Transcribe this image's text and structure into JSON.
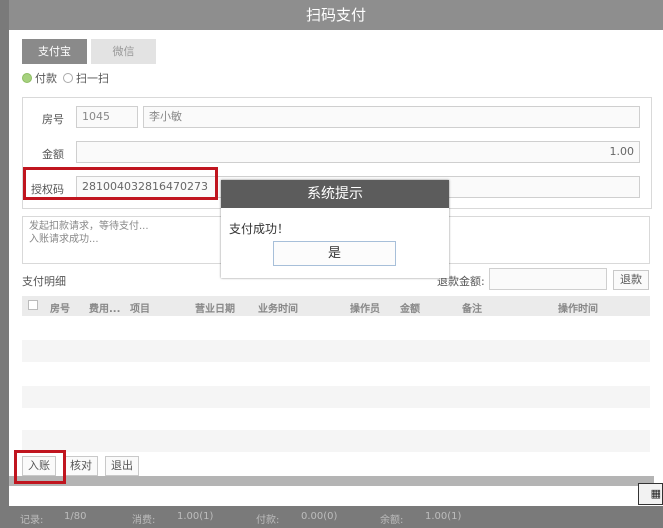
{
  "window": {
    "title": "扫码支付"
  },
  "tabs": [
    {
      "label": "支付宝",
      "active": true
    },
    {
      "label": "微信",
      "active": false
    }
  ],
  "mode": {
    "options": [
      {
        "label": "付款",
        "selected": true
      },
      {
        "label": "扫一扫",
        "selected": false
      }
    ]
  },
  "form": {
    "room_label": "房号",
    "room_value": "1045",
    "guest_value": "李小敏",
    "amount_label": "金额",
    "amount_value": "1.00",
    "auth_label": "授权码",
    "auth_value": "281004032816470273"
  },
  "log": {
    "lines": [
      "发起扣款请求，等待支付...",
      "入账请求成功..."
    ]
  },
  "details": {
    "title": "支付明细",
    "refund_label": "退款金额:",
    "refund_button": "退款",
    "columns": [
      "房号",
      "费用...",
      "项目",
      "营业日期",
      "业务时间",
      "操作员",
      "金额",
      "备注",
      "操作时间"
    ]
  },
  "buttons": {
    "post": "入账",
    "verify": "核对",
    "exit": "退出"
  },
  "dialog": {
    "title": "系统提示",
    "message": "支付成功！",
    "ok": "是"
  },
  "statusbar": {
    "records_label": "记录:",
    "records_value": "1/80",
    "consume_label": "消费:",
    "consume_value": "1.00(1)",
    "paid_label": "付款:",
    "paid_value": "0.00(0)",
    "balance_label": "余额:",
    "balance_value": "1.00(1)"
  },
  "colors": {
    "highlight": "#c0151f",
    "radio_on": "#a6d17e",
    "titlebar": "#8e8e8e"
  }
}
